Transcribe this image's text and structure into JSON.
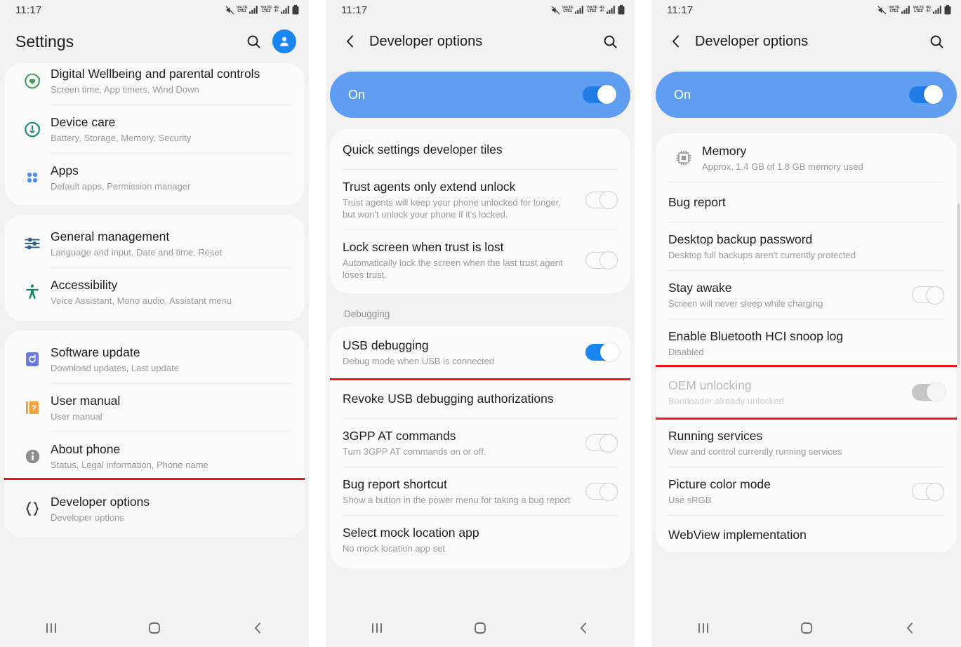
{
  "statusbar": {
    "time": "11:17",
    "icons": [
      "mute-icon",
      "volte-lte1-icon",
      "signal-1-icon",
      "volte-lte2-icon",
      "fourg-plus-icon",
      "signal-2-icon",
      "battery-icon"
    ],
    "volte1": {
      "top": "VoLTE",
      "bottom": "LTE1"
    },
    "volte2": {
      "top": "VoLTE",
      "bottom": "LTE2"
    },
    "fourg": {
      "top": "4G",
      "bottom": "4+"
    }
  },
  "navbar": {
    "recents": "recents-button",
    "home": "home-button",
    "back": "back-button"
  },
  "colors": {
    "accent_blue": "#1a87f0",
    "banner_blue": "#5f9ef0",
    "highlight_red": "#f01616",
    "green": "#3f9c55",
    "teal": "#128a6e",
    "orange": "#f2a33c",
    "indigo": "#6b77e0"
  },
  "screen1": {
    "appbar": {
      "title": "Settings",
      "search_icon": "search-icon",
      "avatar_icon": "account-avatar-icon"
    },
    "groups": [
      {
        "items": [
          {
            "icon": "digital-wellbeing-icon",
            "title": "Digital Wellbeing and parental controls",
            "subtitle": "Screen time, App timers, Wind Down"
          },
          {
            "icon": "device-care-icon",
            "title": "Device care",
            "subtitle": "Battery, Storage, Memory, Security"
          },
          {
            "icon": "apps-icon",
            "title": "Apps",
            "subtitle": "Default apps, Permission manager"
          }
        ]
      },
      {
        "items": [
          {
            "icon": "general-management-icon",
            "title": "General management",
            "subtitle": "Language and input, Date and time, Reset"
          },
          {
            "icon": "accessibility-icon",
            "title": "Accessibility",
            "subtitle": "Voice Assistant, Mono audio, Assistant menu"
          }
        ]
      },
      {
        "items": [
          {
            "icon": "software-update-icon",
            "title": "Software update",
            "subtitle": "Download updates, Last update"
          },
          {
            "icon": "user-manual-icon",
            "title": "User manual",
            "subtitle": "User manual"
          },
          {
            "icon": "about-phone-icon",
            "title": "About phone",
            "subtitle": "Status, Legal information, Phone name"
          },
          {
            "icon": "developer-options-icon",
            "title": "Developer options",
            "subtitle": "Developer options",
            "highlighted": true
          }
        ]
      }
    ]
  },
  "screen2": {
    "appbar": {
      "back_icon": "back-chevron-icon",
      "title": "Developer options",
      "search_icon": "search-icon"
    },
    "banner": {
      "label": "On",
      "toggle": "on"
    },
    "card1": [
      {
        "title": "Quick settings developer tiles",
        "subtitle": "",
        "toggle": "none"
      },
      {
        "title": "Trust agents only extend unlock",
        "subtitle": "Trust agents will keep your phone unlocked for longer, but won't unlock your phone if it's locked.",
        "toggle": "off"
      },
      {
        "title": "Lock screen when trust is lost",
        "subtitle": "Automatically lock the screen when the last trust agent loses trust.",
        "toggle": "off"
      }
    ],
    "section": "Debugging",
    "card2": [
      {
        "title": "USB debugging",
        "subtitle": "Debug mode when USB is connected",
        "toggle": "on",
        "highlighted": true
      },
      {
        "title": "Revoke USB debugging authorizations",
        "subtitle": "",
        "toggle": "none"
      },
      {
        "title": "3GPP AT commands",
        "subtitle": "Turn 3GPP AT commands on or off.",
        "toggle": "off"
      },
      {
        "title": "Bug report shortcut",
        "subtitle": "Show a button in the power menu for taking a bug report",
        "toggle": "off"
      },
      {
        "title": "Select mock location app",
        "subtitle": "No mock location app set",
        "toggle": "none"
      }
    ]
  },
  "screen3": {
    "appbar": {
      "back_icon": "back-chevron-icon",
      "title": "Developer options",
      "search_icon": "search-icon"
    },
    "banner": {
      "label": "On",
      "toggle": "on"
    },
    "items": [
      {
        "icon": "memory-chip-icon",
        "title": "Memory",
        "subtitle": "Approx. 1.4 GB of 1.8 GB memory used",
        "toggle": "none"
      },
      {
        "icon": "",
        "title": "Bug report",
        "subtitle": "",
        "toggle": "none"
      },
      {
        "icon": "",
        "title": "Desktop backup password",
        "subtitle": "Desktop full backups aren't currently protected",
        "toggle": "none"
      },
      {
        "icon": "",
        "title": "Stay awake",
        "subtitle": "Screen will never sleep while charging",
        "toggle": "off"
      },
      {
        "icon": "",
        "title": "Enable Bluetooth HCI snoop log",
        "subtitle": "Disabled",
        "toggle": "none"
      },
      {
        "icon": "",
        "title": "OEM unlocking",
        "subtitle": "Bootloader already unlocked",
        "toggle": "ongrey",
        "dim": true,
        "highlighted": true
      },
      {
        "icon": "",
        "title": "Running services",
        "subtitle": "View and control currently running services",
        "toggle": "none"
      },
      {
        "icon": "",
        "title": "Picture color mode",
        "subtitle": "Use sRGB",
        "toggle": "off"
      },
      {
        "icon": "",
        "title": "WebView implementation",
        "subtitle": "",
        "toggle": "none"
      }
    ]
  }
}
